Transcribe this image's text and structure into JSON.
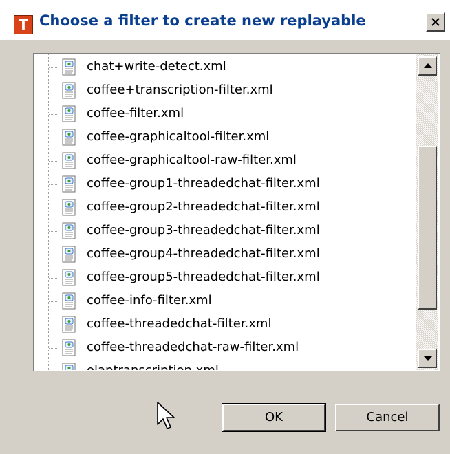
{
  "window": {
    "title": "Choose a filter to create new replayable",
    "icon_letter": "T",
    "icon_color": "#d8431a",
    "title_color": "#0a3f8f"
  },
  "tree": {
    "items": [
      {
        "label": "chat+write-detect.xml",
        "icon": "xml-file-icon"
      },
      {
        "label": "coffee+transcription-filter.xml",
        "icon": "xml-file-icon"
      },
      {
        "label": "coffee-filter.xml",
        "icon": "xml-file-icon"
      },
      {
        "label": "coffee-graphicaltool-filter.xml",
        "icon": "xml-file-icon"
      },
      {
        "label": "coffee-graphicaltool-raw-filter.xml",
        "icon": "xml-file-icon"
      },
      {
        "label": "coffee-group1-threadedchat-filter.xml",
        "icon": "xml-file-icon"
      },
      {
        "label": "coffee-group2-threadedchat-filter.xml",
        "icon": "xml-file-icon"
      },
      {
        "label": "coffee-group3-threadedchat-filter.xml",
        "icon": "xml-file-icon"
      },
      {
        "label": "coffee-group4-threadedchat-filter.xml",
        "icon": "xml-file-icon"
      },
      {
        "label": "coffee-group5-threadedchat-filter.xml",
        "icon": "xml-file-icon"
      },
      {
        "label": "coffee-info-filter.xml",
        "icon": "xml-file-icon"
      },
      {
        "label": "coffee-threadedchat-filter.xml",
        "icon": "xml-file-icon"
      },
      {
        "label": "coffee-threadedchat-raw-filter.xml",
        "icon": "xml-file-icon"
      },
      {
        "label": "olaptranscription.xml",
        "icon": "xml-file-icon"
      }
    ]
  },
  "buttons": {
    "ok_label": "OK",
    "cancel_label": "Cancel"
  }
}
